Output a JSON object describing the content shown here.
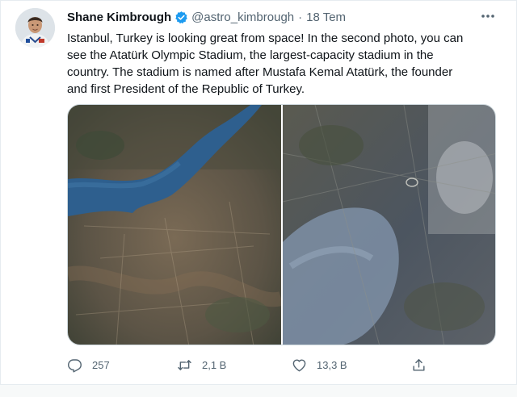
{
  "tweet": {
    "author_name": "Shane Kimbrough",
    "handle": "@astro_kimbrough",
    "separator": "·",
    "date": "18 Tem",
    "text": "Istanbul, Turkey is looking great from space! In the second photo, you can\nsee the Atatürk Olympic Stadium, the largest-capacity stadium in the\ncountry. The stadium is named after Mustafa Kemal Atatürk, the founder\nand first President of the Republic of Turkey.",
    "photos": [
      {
        "name": "bosphorus-satellite-photo"
      },
      {
        "name": "ataturk-stadium-satellite-photo"
      }
    ]
  },
  "actions": {
    "reply": {
      "icon": "reply-icon",
      "count": "257"
    },
    "retweet": {
      "icon": "retweet-icon",
      "count": "2,1 B"
    },
    "like": {
      "icon": "heart-icon",
      "count": "13,3 B"
    },
    "share": {
      "icon": "share-icon"
    }
  },
  "colors": {
    "text": "#0f1419",
    "secondary": "#536471",
    "verified": "#1d9bf0",
    "border": "#e6ecf0"
  }
}
